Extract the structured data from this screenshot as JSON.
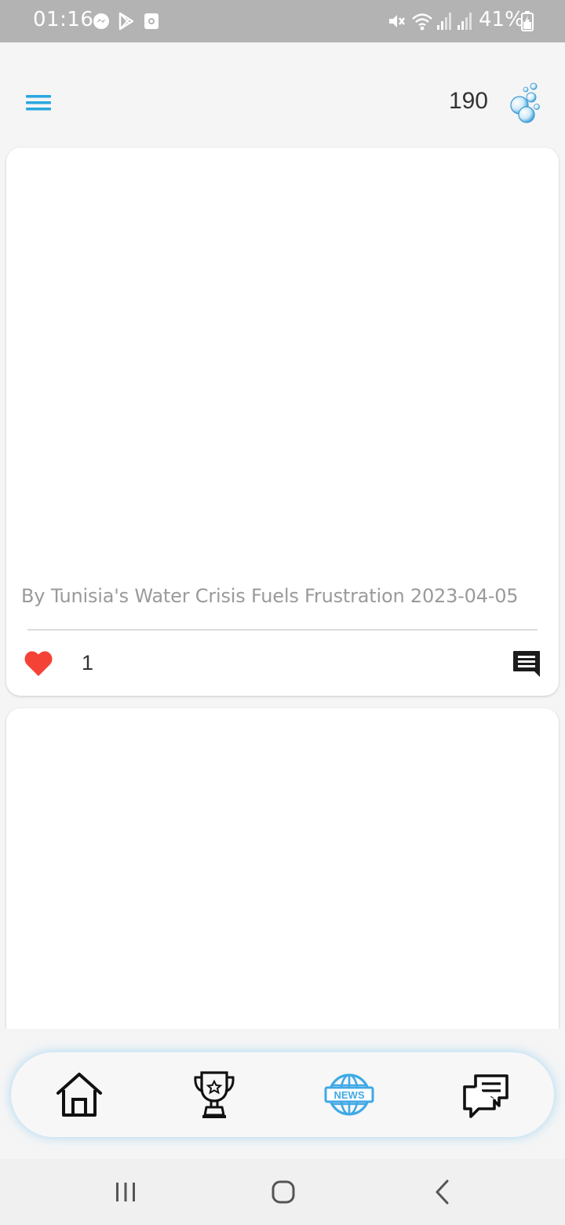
{
  "status_bar": {
    "time": "01:16",
    "battery": "41%",
    "icons": [
      "messenger-icon",
      "play-store-icon",
      "screen-recorder-icon",
      "mute-icon",
      "wifi-icon",
      "signal-icon",
      "signal-icon",
      "battery-charging-icon"
    ]
  },
  "header": {
    "points": "190",
    "menu_icon": "hamburger-menu-icon",
    "points_icon": "water-bubbles-icon"
  },
  "posts": [
    {
      "caption": "By Tunisia's Water Crisis Fuels Frustration 2023-04-05",
      "likes": "1",
      "liked": true
    }
  ],
  "bottom_nav": {
    "items": [
      {
        "name": "home",
        "icon": "home-icon",
        "active": false
      },
      {
        "name": "trophy",
        "icon": "trophy-icon",
        "active": false
      },
      {
        "name": "news",
        "icon": "news-globe-icon",
        "label": "NEWS",
        "active": true
      },
      {
        "name": "chat",
        "icon": "chat-icon",
        "active": false
      }
    ]
  },
  "colors": {
    "accent": "#29a8e0",
    "like": "#f44336",
    "status_bar": "#b3b3b3",
    "background": "#f5f5f5"
  }
}
